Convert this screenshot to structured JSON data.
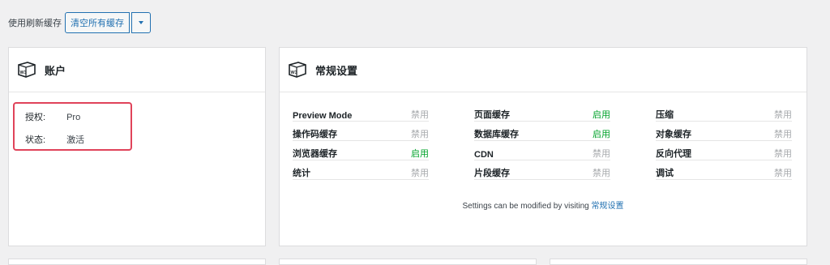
{
  "toolbar": {
    "label": "使用刷新缓存",
    "clear_button": "清空所有缓存"
  },
  "account": {
    "title": "账户",
    "rows": [
      {
        "key": "授权:",
        "value": "Pro"
      },
      {
        "key": "状态:",
        "value": "激活"
      }
    ]
  },
  "general": {
    "title": "常规设置",
    "items": [
      {
        "name": "Preview Mode",
        "status": "禁用",
        "on": false
      },
      {
        "name": "操作码缓存",
        "status": "禁用",
        "on": false
      },
      {
        "name": "浏览器缓存",
        "status": "启用",
        "on": true
      },
      {
        "name": "统计",
        "status": "禁用",
        "on": false
      },
      {
        "name": "页面缓存",
        "status": "启用",
        "on": true
      },
      {
        "name": "数据库缓存",
        "status": "启用",
        "on": true
      },
      {
        "name": "CDN",
        "status": "禁用",
        "on": false
      },
      {
        "name": "片段缓存",
        "status": "禁用",
        "on": false
      },
      {
        "name": "压缩",
        "status": "禁用",
        "on": false
      },
      {
        "name": "对象缓存",
        "status": "禁用",
        "on": false
      },
      {
        "name": "反向代理",
        "status": "禁用",
        "on": false
      },
      {
        "name": "调试",
        "status": "禁用",
        "on": false
      }
    ],
    "footer_text": "Settings can be modified by visiting",
    "footer_link": "常规设置"
  },
  "colors": {
    "accent": "#2271b1",
    "enabled": "#00a32a",
    "disabled": "#a7aaad",
    "highlight": "#e0435a"
  }
}
